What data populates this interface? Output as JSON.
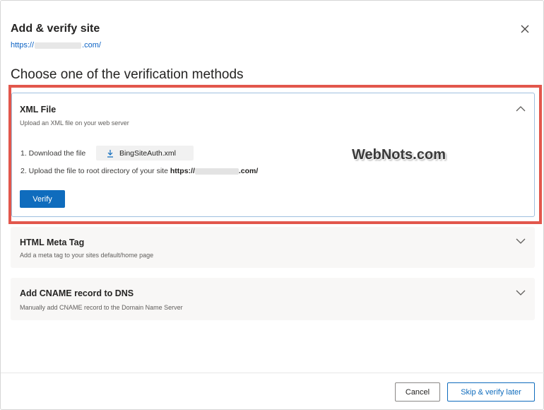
{
  "dialog": {
    "title": "Add & verify site",
    "url_prefix": "https://",
    "url_suffix": ".com/",
    "heading": "Choose one of the verification methods"
  },
  "xml_card": {
    "title": "XML File",
    "subtitle": "Upload an XML file on your web server",
    "step1_label": "1. Download the file",
    "download_file": "BingSiteAuth.xml",
    "step2_label": "2. Upload the file to root directory of your site",
    "step2_url_prefix": "https://",
    "step2_url_suffix": ".com/",
    "verify_label": "Verify",
    "expanded": true
  },
  "meta_card": {
    "title": "HTML Meta Tag",
    "subtitle": "Add a meta tag to your sites default/home page",
    "expanded": false
  },
  "cname_card": {
    "title": "Add CNAME record to DNS",
    "subtitle": "Manually add CNAME record to the Domain Name Server",
    "expanded": false
  },
  "footer": {
    "cancel_label": "Cancel",
    "skip_label": "Skip & verify later"
  },
  "watermark": "WebNots.com",
  "icons": {
    "close": "close-icon",
    "chevron_up": "chevron-up-icon",
    "chevron_down": "chevron-down-icon",
    "download": "download-icon"
  },
  "colors": {
    "accent": "#0f6cbd",
    "link": "#0b62c4",
    "highlight": "#e2574c",
    "card_grey": "#f8f7f6"
  }
}
